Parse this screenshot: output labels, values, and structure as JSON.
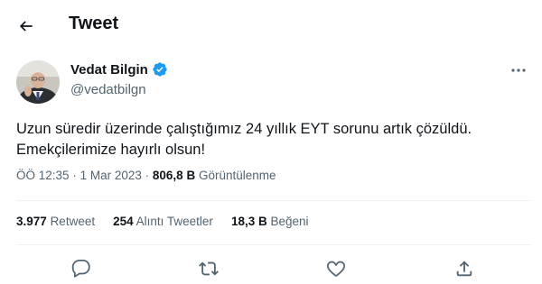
{
  "header": {
    "title": "Tweet",
    "back_icon": "arrow-left-icon"
  },
  "author": {
    "name": "Vedat Bilgin",
    "handle": "@vedatbilgn",
    "verified": true,
    "verified_icon": "verified-badge-icon",
    "verified_color": "#1d9bf0"
  },
  "tweet": {
    "lines": [
      "Uzun süredir üzerinde çalıştığımız 24 yıllık EYT sorunu artık çözüldü.",
      "Emekçilerimize hayırlı olsun!"
    ],
    "time": "ÖÖ 12:35",
    "separator": "·",
    "date": "1 Mar 2023",
    "views_count": "806,8 B",
    "views_label": "Görüntülenme"
  },
  "stats": {
    "retweets_count": "3.977",
    "retweets_label": "Retweet",
    "quotes_count": "254",
    "quotes_label": "Alıntı Tweetler",
    "likes_count": "18,3 B",
    "likes_label": "Beğeni"
  },
  "actions": [
    "reply-icon",
    "retweet-icon",
    "like-icon",
    "share-icon"
  ],
  "colors": {
    "text": "#0f1419",
    "secondary": "#536471",
    "divider": "#eff3f4"
  }
}
